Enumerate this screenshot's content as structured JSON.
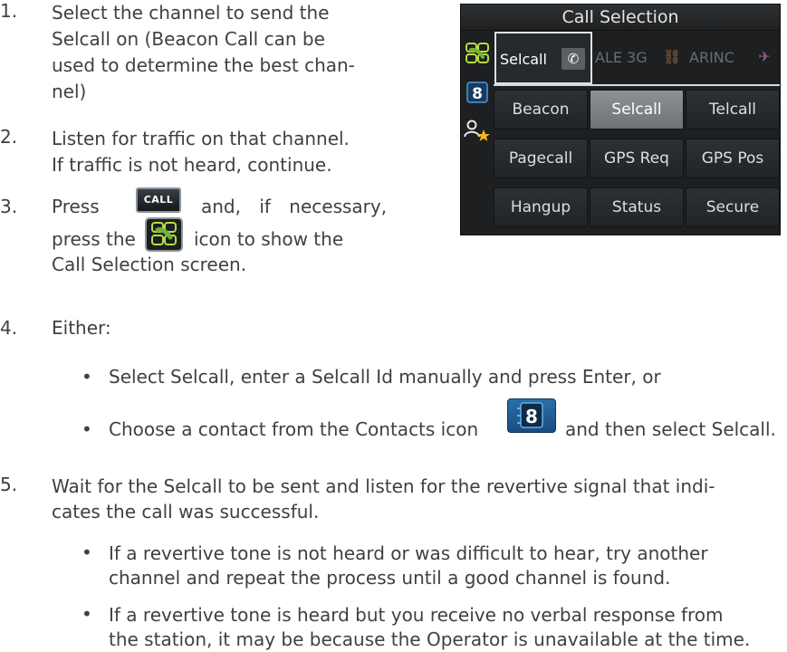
{
  "steps": [
    {
      "n": "1.",
      "lines": [
        "Select the channel to send the",
        "Selcall on (Beacon Call can be",
        "used to determine the best chan-",
        "nel)"
      ]
    },
    {
      "n": "2.",
      "lines": [
        "Listen for traffic on that channel.",
        "If traffic is not heard, continue."
      ]
    },
    {
      "n": "3.",
      "lines": [
        "Press",
        "and, if necessary,",
        "press the",
        "icon to show the",
        "Call Selection screen."
      ]
    },
    {
      "n": "4.",
      "lines": [
        "Either:"
      ]
    },
    {
      "n": "5.",
      "lines": [
        "Wait for the Selcall to be sent and listen for the revertive signal that indi-",
        "cates the call was successful."
      ]
    }
  ],
  "step4_bullets": [
    "Select Selcall, enter a Selcall Id manually and press Enter, or",
    "Choose a contact from the Contacts icon",
    "and then select Selcall."
  ],
  "step5_bullets": [
    [
      "If a revertive tone is not heard or was difficult to hear, try another",
      "channel and repeat the process until a good channel is found."
    ],
    [
      "If a revertive tone is heard but you receive no verbal response from",
      "the station, it may be because the Operator is unavailable at the time."
    ]
  ],
  "call_key_label": "CALL",
  "contacts_icon_glyph": "8",
  "panel": {
    "title": "Call Selection",
    "tabs": [
      "Selcall",
      "ALE 3G",
      "ARINC"
    ],
    "buttons": [
      [
        "Beacon",
        "Selcall",
        "Telcall"
      ],
      [
        "Pagecall",
        "GPS Req",
        "GPS Pos"
      ],
      [
        "Hangup",
        "Status",
        "Secure"
      ]
    ],
    "selected_button": "Selcall",
    "side_icons": [
      "call-selection-icon",
      "contacts-icon",
      "favorites-icon"
    ]
  },
  "colors": {
    "text": "#404040",
    "panel_bg": "#1d1f21",
    "accent_blue": "#2a6fa9",
    "selected": "#7d8286"
  }
}
